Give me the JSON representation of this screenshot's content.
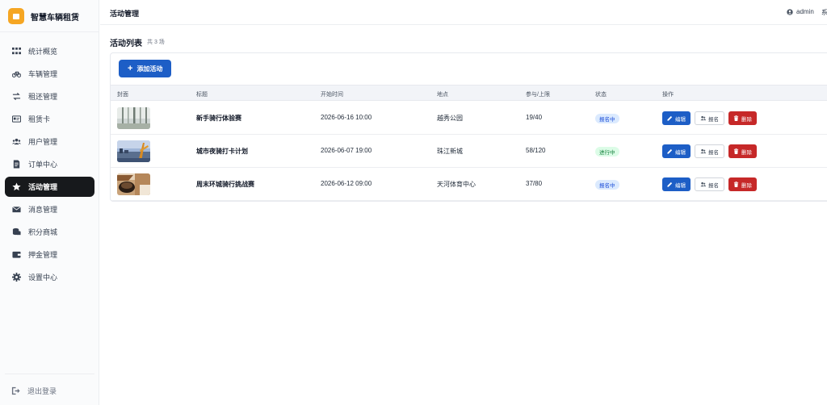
{
  "brand": {
    "name": "智慧车辆租赁",
    "color": "#f5a623"
  },
  "sidebar": {
    "items": [
      {
        "label": "统计概览",
        "icon": "grid-icon",
        "active": false
      },
      {
        "label": "车辆管理",
        "icon": "bicycle-icon",
        "active": false
      },
      {
        "label": "租还管理",
        "icon": "exchange-icon",
        "active": false
      },
      {
        "label": "租赁卡",
        "icon": "id-card-icon",
        "active": false
      },
      {
        "label": "用户管理",
        "icon": "users-icon",
        "active": false
      },
      {
        "label": "订单中心",
        "icon": "document-icon",
        "active": false
      },
      {
        "label": "活动管理",
        "icon": "star-icon",
        "active": true
      },
      {
        "label": "消息管理",
        "icon": "envelope-icon",
        "active": false
      },
      {
        "label": "积分商城",
        "icon": "coins-icon",
        "active": false
      },
      {
        "label": "押金管理",
        "icon": "wallet-icon",
        "active": false
      },
      {
        "label": "设置中心",
        "icon": "gear-icon",
        "active": false
      }
    ],
    "logout_label": "退出登录"
  },
  "header": {
    "title": "活动管理",
    "user": "admin",
    "extra": "系"
  },
  "main": {
    "list_title": "活动列表",
    "count_text": "共 3 场",
    "add_button": "添加活动",
    "columns": [
      "封面",
      "标题",
      "开始时间",
      "地点",
      "参与/上限",
      "状态",
      "操作"
    ],
    "rows": [
      {
        "title": "新手骑行体验赛",
        "start": "2026-06-16 10:00",
        "place": "越秀公园",
        "quota": "19/40",
        "status": "报名中",
        "status_color": "blue",
        "cover": "forest"
      },
      {
        "title": "城市夜骑打卡计划",
        "start": "2026-06-07 19:00",
        "place": "珠江新城",
        "quota": "58/120",
        "status": "进行中",
        "status_color": "green",
        "cover": "city"
      },
      {
        "title": "周末环城骑行挑战赛",
        "start": "2026-06-12 09:00",
        "place": "天河体育中心",
        "quota": "37/80",
        "status": "报名中",
        "status_color": "blue",
        "cover": "coffee"
      }
    ],
    "actions": {
      "edit": "编辑",
      "enroll": "报名",
      "delete": "删除"
    }
  },
  "colors": {
    "primary": "#1d5ec6",
    "danger": "#c62828",
    "active_nav": "#17191c"
  }
}
